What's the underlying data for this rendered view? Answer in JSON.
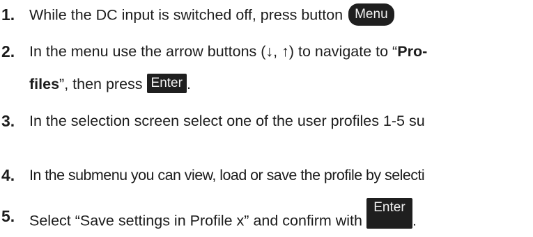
{
  "steps": [
    {
      "num": "1.",
      "text": "While the DC input is switched off, press button",
      "key": "Menu"
    },
    {
      "num": "2.",
      "text_a": "In the menu use the arrow buttons (↓, ↑) to navigate to “",
      "bold_a": "Pro-",
      "bold_b": "files",
      "text_b": "”, then press",
      "key": "Enter",
      "end": "."
    },
    {
      "num": "3.",
      "text": "In the selection screen select one of the user profiles 1-5 su"
    },
    {
      "num": "4.",
      "text": "In the submenu you can view, load or save the profile by selecti"
    },
    {
      "num": "5.",
      "text": "Select “Save settings in Profile x” and confirm with",
      "key": "Enter",
      "end": "."
    }
  ]
}
